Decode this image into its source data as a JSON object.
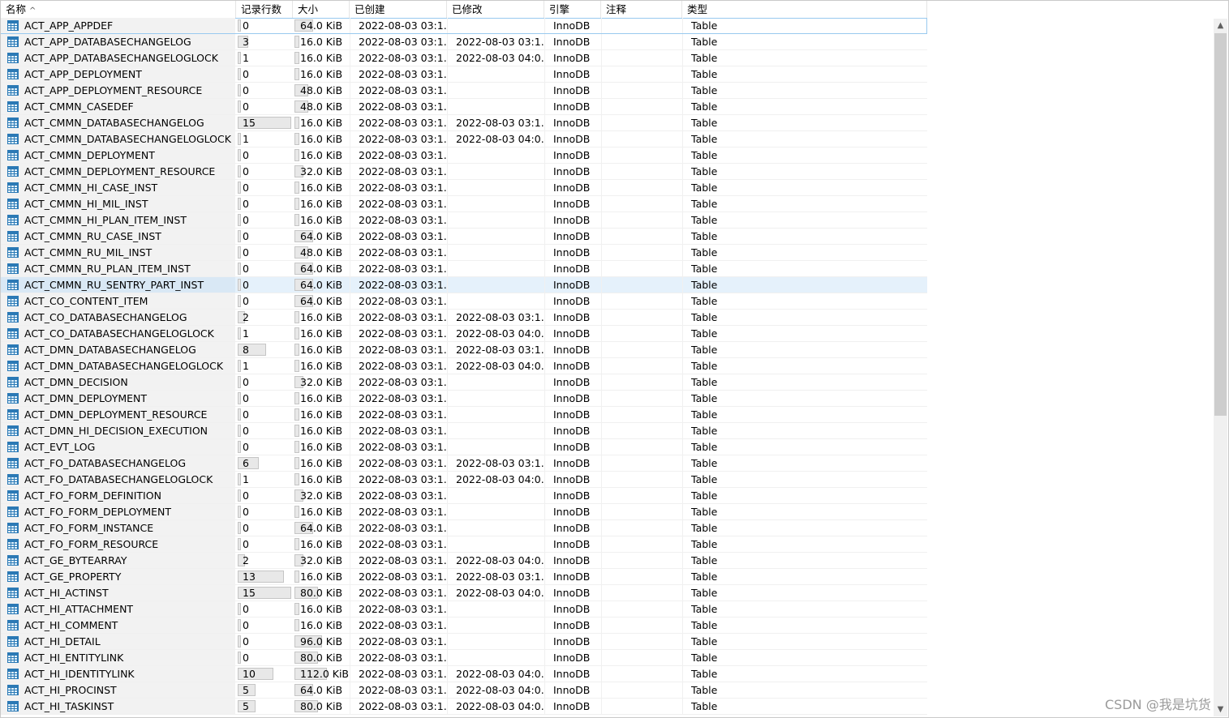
{
  "columns": {
    "name": "名称",
    "rows": "记录行数",
    "size": "大小",
    "created": "已创建",
    "modified": "已修改",
    "engine": "引擎",
    "comment": "注释",
    "type": "类型"
  },
  "sort_indicator": "^",
  "rows": [
    {
      "name": "ACT_APP_APPDEF",
      "rows": "0",
      "size": "64.0 KiB",
      "created": "2022-08-03 03:1...",
      "modified": "",
      "engine": "InnoDB",
      "type": "Table"
    },
    {
      "name": "ACT_APP_DATABASECHANGELOG",
      "rows": "3",
      "size": "16.0 KiB",
      "created": "2022-08-03 03:1...",
      "modified": "2022-08-03 03:1...",
      "engine": "InnoDB",
      "type": "Table"
    },
    {
      "name": "ACT_APP_DATABASECHANGELOGLOCK",
      "rows": "1",
      "size": "16.0 KiB",
      "created": "2022-08-03 03:1...",
      "modified": "2022-08-03 04:0...",
      "engine": "InnoDB",
      "type": "Table"
    },
    {
      "name": "ACT_APP_DEPLOYMENT",
      "rows": "0",
      "size": "16.0 KiB",
      "created": "2022-08-03 03:1...",
      "modified": "",
      "engine": "InnoDB",
      "type": "Table"
    },
    {
      "name": "ACT_APP_DEPLOYMENT_RESOURCE",
      "rows": "0",
      "size": "48.0 KiB",
      "created": "2022-08-03 03:1...",
      "modified": "",
      "engine": "InnoDB",
      "type": "Table"
    },
    {
      "name": "ACT_CMMN_CASEDEF",
      "rows": "0",
      "size": "48.0 KiB",
      "created": "2022-08-03 03:1...",
      "modified": "",
      "engine": "InnoDB",
      "type": "Table"
    },
    {
      "name": "ACT_CMMN_DATABASECHANGELOG",
      "rows": "15",
      "size": "16.0 KiB",
      "created": "2022-08-03 03:1...",
      "modified": "2022-08-03 03:1...",
      "engine": "InnoDB",
      "type": "Table"
    },
    {
      "name": "ACT_CMMN_DATABASECHANGELOGLOCK",
      "rows": "1",
      "size": "16.0 KiB",
      "created": "2022-08-03 03:1...",
      "modified": "2022-08-03 04:0...",
      "engine": "InnoDB",
      "type": "Table"
    },
    {
      "name": "ACT_CMMN_DEPLOYMENT",
      "rows": "0",
      "size": "16.0 KiB",
      "created": "2022-08-03 03:1...",
      "modified": "",
      "engine": "InnoDB",
      "type": "Table"
    },
    {
      "name": "ACT_CMMN_DEPLOYMENT_RESOURCE",
      "rows": "0",
      "size": "32.0 KiB",
      "created": "2022-08-03 03:1...",
      "modified": "",
      "engine": "InnoDB",
      "type": "Table"
    },
    {
      "name": "ACT_CMMN_HI_CASE_INST",
      "rows": "0",
      "size": "16.0 KiB",
      "created": "2022-08-03 03:1...",
      "modified": "",
      "engine": "InnoDB",
      "type": "Table"
    },
    {
      "name": "ACT_CMMN_HI_MIL_INST",
      "rows": "0",
      "size": "16.0 KiB",
      "created": "2022-08-03 03:1...",
      "modified": "",
      "engine": "InnoDB",
      "type": "Table"
    },
    {
      "name": "ACT_CMMN_HI_PLAN_ITEM_INST",
      "rows": "0",
      "size": "16.0 KiB",
      "created": "2022-08-03 03:1...",
      "modified": "",
      "engine": "InnoDB",
      "type": "Table"
    },
    {
      "name": "ACT_CMMN_RU_CASE_INST",
      "rows": "0",
      "size": "64.0 KiB",
      "created": "2022-08-03 03:1...",
      "modified": "",
      "engine": "InnoDB",
      "type": "Table"
    },
    {
      "name": "ACT_CMMN_RU_MIL_INST",
      "rows": "0",
      "size": "48.0 KiB",
      "created": "2022-08-03 03:1...",
      "modified": "",
      "engine": "InnoDB",
      "type": "Table"
    },
    {
      "name": "ACT_CMMN_RU_PLAN_ITEM_INST",
      "rows": "0",
      "size": "64.0 KiB",
      "created": "2022-08-03 03:1...",
      "modified": "",
      "engine": "InnoDB",
      "type": "Table"
    },
    {
      "name": "ACT_CMMN_RU_SENTRY_PART_INST",
      "rows": "0",
      "size": "64.0 KiB",
      "created": "2022-08-03 03:1...",
      "modified": "",
      "engine": "InnoDB",
      "type": "Table"
    },
    {
      "name": "ACT_CO_CONTENT_ITEM",
      "rows": "0",
      "size": "64.0 KiB",
      "created": "2022-08-03 03:1...",
      "modified": "",
      "engine": "InnoDB",
      "type": "Table"
    },
    {
      "name": "ACT_CO_DATABASECHANGELOG",
      "rows": "2",
      "size": "16.0 KiB",
      "created": "2022-08-03 03:1...",
      "modified": "2022-08-03 03:1...",
      "engine": "InnoDB",
      "type": "Table"
    },
    {
      "name": "ACT_CO_DATABASECHANGELOGLOCK",
      "rows": "1",
      "size": "16.0 KiB",
      "created": "2022-08-03 03:1...",
      "modified": "2022-08-03 04:0...",
      "engine": "InnoDB",
      "type": "Table"
    },
    {
      "name": "ACT_DMN_DATABASECHANGELOG",
      "rows": "8",
      "size": "16.0 KiB",
      "created": "2022-08-03 03:1...",
      "modified": "2022-08-03 03:1...",
      "engine": "InnoDB",
      "type": "Table"
    },
    {
      "name": "ACT_DMN_DATABASECHANGELOGLOCK",
      "rows": "1",
      "size": "16.0 KiB",
      "created": "2022-08-03 03:1...",
      "modified": "2022-08-03 04:0...",
      "engine": "InnoDB",
      "type": "Table"
    },
    {
      "name": "ACT_DMN_DECISION",
      "rows": "0",
      "size": "32.0 KiB",
      "created": "2022-08-03 03:1...",
      "modified": "",
      "engine": "InnoDB",
      "type": "Table"
    },
    {
      "name": "ACT_DMN_DEPLOYMENT",
      "rows": "0",
      "size": "16.0 KiB",
      "created": "2022-08-03 03:1...",
      "modified": "",
      "engine": "InnoDB",
      "type": "Table"
    },
    {
      "name": "ACT_DMN_DEPLOYMENT_RESOURCE",
      "rows": "0",
      "size": "16.0 KiB",
      "created": "2022-08-03 03:1...",
      "modified": "",
      "engine": "InnoDB",
      "type": "Table"
    },
    {
      "name": "ACT_DMN_HI_DECISION_EXECUTION",
      "rows": "0",
      "size": "16.0 KiB",
      "created": "2022-08-03 03:1...",
      "modified": "",
      "engine": "InnoDB",
      "type": "Table"
    },
    {
      "name": "ACT_EVT_LOG",
      "rows": "0",
      "size": "16.0 KiB",
      "created": "2022-08-03 03:1...",
      "modified": "",
      "engine": "InnoDB",
      "type": "Table"
    },
    {
      "name": "ACT_FO_DATABASECHANGELOG",
      "rows": "6",
      "size": "16.0 KiB",
      "created": "2022-08-03 03:1...",
      "modified": "2022-08-03 03:1...",
      "engine": "InnoDB",
      "type": "Table"
    },
    {
      "name": "ACT_FO_DATABASECHANGELOGLOCK",
      "rows": "1",
      "size": "16.0 KiB",
      "created": "2022-08-03 03:1...",
      "modified": "2022-08-03 04:0...",
      "engine": "InnoDB",
      "type": "Table"
    },
    {
      "name": "ACT_FO_FORM_DEFINITION",
      "rows": "0",
      "size": "32.0 KiB",
      "created": "2022-08-03 03:1...",
      "modified": "",
      "engine": "InnoDB",
      "type": "Table"
    },
    {
      "name": "ACT_FO_FORM_DEPLOYMENT",
      "rows": "0",
      "size": "16.0 KiB",
      "created": "2022-08-03 03:1...",
      "modified": "",
      "engine": "InnoDB",
      "type": "Table"
    },
    {
      "name": "ACT_FO_FORM_INSTANCE",
      "rows": "0",
      "size": "64.0 KiB",
      "created": "2022-08-03 03:1...",
      "modified": "",
      "engine": "InnoDB",
      "type": "Table"
    },
    {
      "name": "ACT_FO_FORM_RESOURCE",
      "rows": "0",
      "size": "16.0 KiB",
      "created": "2022-08-03 03:1...",
      "modified": "",
      "engine": "InnoDB",
      "type": "Table"
    },
    {
      "name": "ACT_GE_BYTEARRAY",
      "rows": "2",
      "size": "32.0 KiB",
      "created": "2022-08-03 03:1...",
      "modified": "2022-08-03 04:0...",
      "engine": "InnoDB",
      "type": "Table"
    },
    {
      "name": "ACT_GE_PROPERTY",
      "rows": "13",
      "size": "16.0 KiB",
      "created": "2022-08-03 03:1...",
      "modified": "2022-08-03 03:1...",
      "engine": "InnoDB",
      "type": "Table"
    },
    {
      "name": "ACT_HI_ACTINST",
      "rows": "15",
      "size": "80.0 KiB",
      "created": "2022-08-03 03:1...",
      "modified": "2022-08-03 04:0...",
      "engine": "InnoDB",
      "type": "Table"
    },
    {
      "name": "ACT_HI_ATTACHMENT",
      "rows": "0",
      "size": "16.0 KiB",
      "created": "2022-08-03 03:1...",
      "modified": "",
      "engine": "InnoDB",
      "type": "Table"
    },
    {
      "name": "ACT_HI_COMMENT",
      "rows": "0",
      "size": "16.0 KiB",
      "created": "2022-08-03 03:1...",
      "modified": "",
      "engine": "InnoDB",
      "type": "Table"
    },
    {
      "name": "ACT_HI_DETAIL",
      "rows": "0",
      "size": "96.0 KiB",
      "created": "2022-08-03 03:1...",
      "modified": "",
      "engine": "InnoDB",
      "type": "Table"
    },
    {
      "name": "ACT_HI_ENTITYLINK",
      "rows": "0",
      "size": "80.0 KiB",
      "created": "2022-08-03 03:1...",
      "modified": "",
      "engine": "InnoDB",
      "type": "Table"
    },
    {
      "name": "ACT_HI_IDENTITYLINK",
      "rows": "10",
      "size": "112.0 KiB",
      "created": "2022-08-03 03:1...",
      "modified": "2022-08-03 04:0...",
      "engine": "InnoDB",
      "type": "Table"
    },
    {
      "name": "ACT_HI_PROCINST",
      "rows": "5",
      "size": "64.0 KiB",
      "created": "2022-08-03 03:1...",
      "modified": "2022-08-03 04:0...",
      "engine": "InnoDB",
      "type": "Table"
    },
    {
      "name": "ACT_HI_TASKINST",
      "rows": "5",
      "size": "80.0 KiB",
      "created": "2022-08-03 03:1...",
      "modified": "2022-08-03 04:0...",
      "engine": "InnoDB",
      "type": "Table"
    }
  ],
  "selected_row": 0,
  "hover_row": 16,
  "row_bar_fraction_max_rows": 15,
  "size_bar_fraction_max_kib": 112,
  "scrollbar": {
    "up_arrow": "▲",
    "down_arrow": "▼"
  },
  "watermark": "CSDN @我是坑货"
}
